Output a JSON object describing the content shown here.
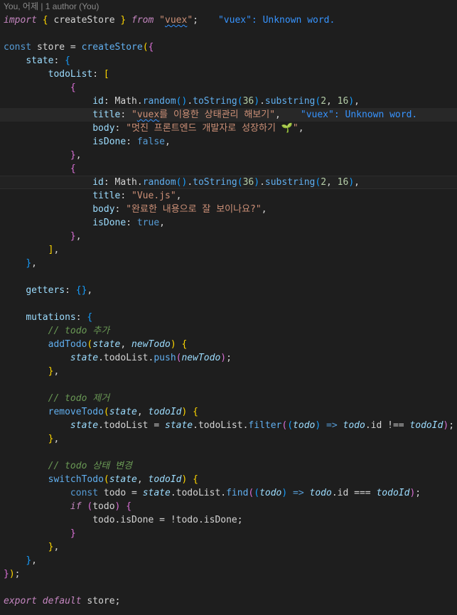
{
  "blame": "You, 어제 | 1 author (You)",
  "hints": {
    "vuex_unknown": "\"vuex\": Unknown word."
  },
  "code": {
    "import_kw": "import",
    "from_kw": "from",
    "import_name": "createStore",
    "import_source": "\"vuex\"",
    "const_kw": "const",
    "store_name": "store",
    "createStore_fn": "createStore",
    "state_key": "state",
    "todoList_key": "todoList",
    "id_key": "id",
    "title_key": "title",
    "body_key": "body",
    "isDone_key": "isDone",
    "math": "Math",
    "random": "random",
    "toString": "toString",
    "substring": "substring",
    "n36": "36",
    "n2": "2",
    "n16": "16",
    "title1": "\"vuex를 이용한 상태관리 해보기\"",
    "title1_head": "\"",
    "title1_word": "vuex",
    "title1_tail": "를 이용한 상태관리 해보기\"",
    "body1": "\"멋진 프론트엔드 개발자로 성장하기 🌱\"",
    "false": "false",
    "title2": "\"Vue.js\"",
    "body2": "\"완료한 내용으로 잘 보이나요?\"",
    "true": "true",
    "getters_key": "getters",
    "mutations_key": "mutations",
    "comment_add": "// todo 추가",
    "addTodo": "addTodo",
    "p_state": "state",
    "p_newTodo": "newTodo",
    "push": "push",
    "comment_remove": "// todo 제거",
    "removeTodo": "removeTodo",
    "p_todoId": "todoId",
    "filter": "filter",
    "p_todo": "todo",
    "comment_switch": "// todo 상태 변경",
    "switchTodo": "switchTodo",
    "find": "find",
    "if_kw": "if",
    "todo_var": "todo",
    "export_kw": "export",
    "default_kw": "default"
  }
}
